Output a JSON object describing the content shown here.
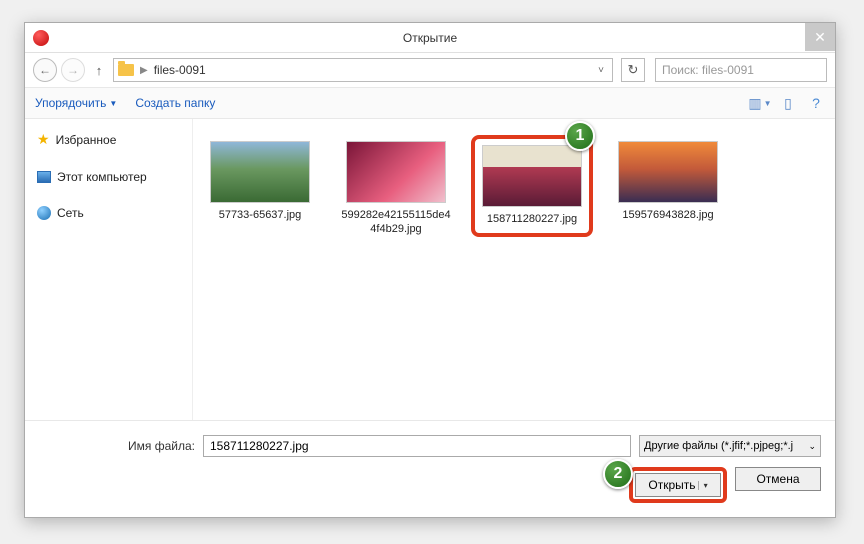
{
  "title": "Открытие",
  "nav": {
    "path_folder": "files-0091",
    "search_placeholder": "Поиск: files-0091"
  },
  "toolbar": {
    "organize": "Упорядочить",
    "new_folder": "Создать папку"
  },
  "sidebar": {
    "favorites": "Избранное",
    "this_pc": "Этот компьютер",
    "network": "Сеть"
  },
  "files": [
    {
      "name": "57733-65637.jpg"
    },
    {
      "name": "599282e42155115de44f4b29.jpg"
    },
    {
      "name": "158711280227.jpg"
    },
    {
      "name": "159576943828.jpg"
    }
  ],
  "footer": {
    "filename_label": "Имя файла:",
    "filename_value": "158711280227.jpg",
    "filetype_value": "Другие файлы (*.jfif;*.pjpeg;*.j",
    "open": "Открыть",
    "cancel": "Отмена"
  },
  "callouts": {
    "one": "1",
    "two": "2"
  }
}
